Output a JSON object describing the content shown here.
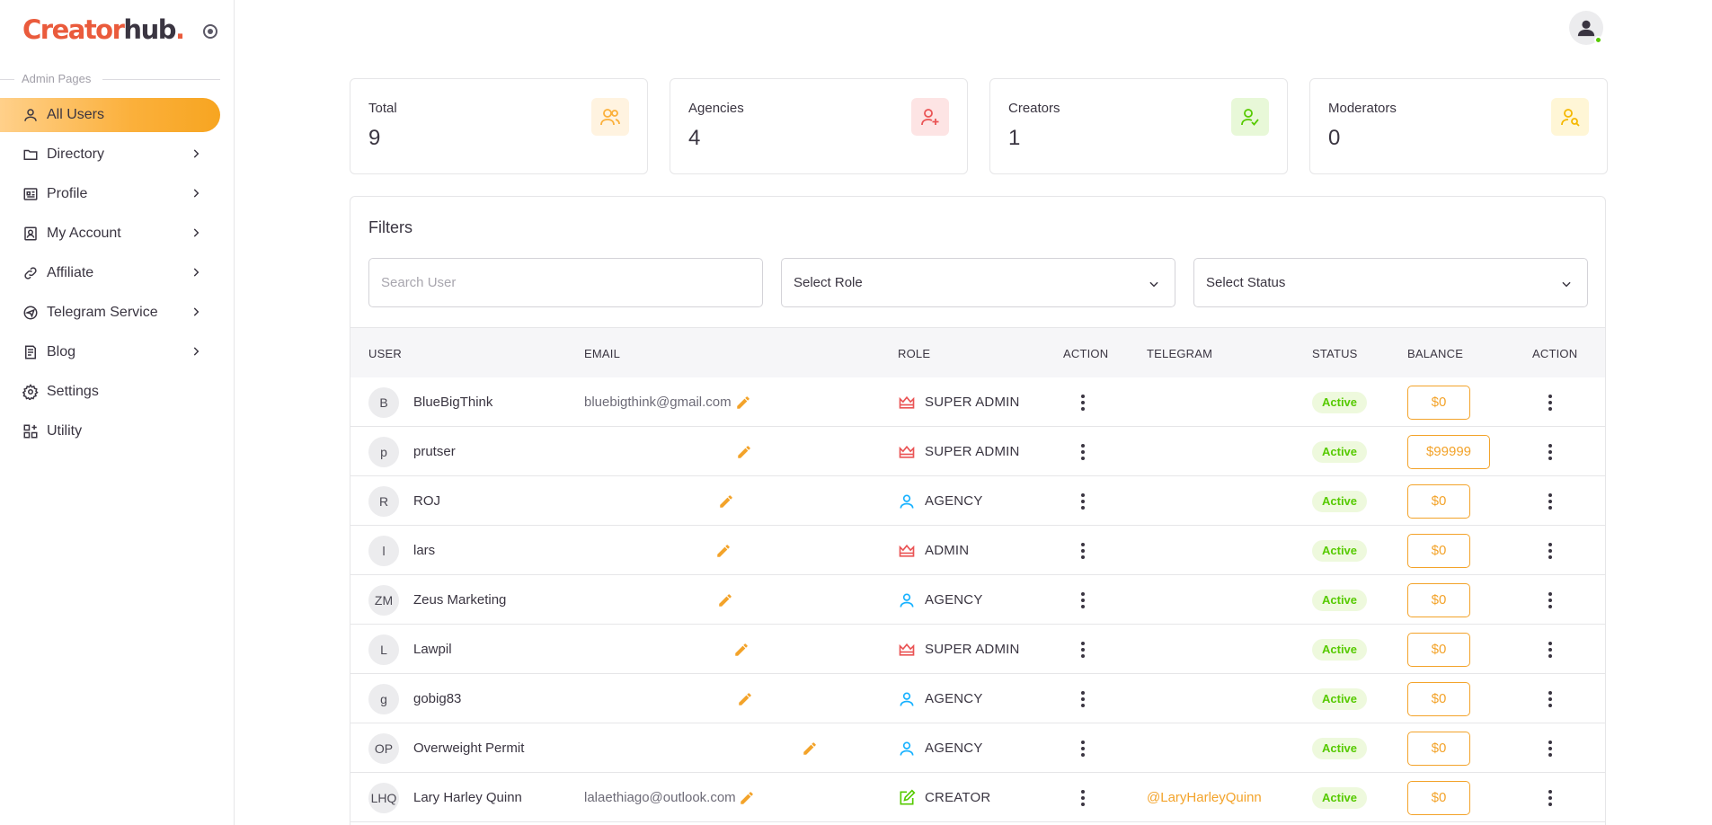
{
  "brand": {
    "part1": "Creator",
    "part2": "hub",
    "dot": "."
  },
  "sidebar": {
    "section_label": "Admin Pages",
    "items": [
      {
        "label": "All Users",
        "icon": "user-icon"
      },
      {
        "label": "Directory",
        "icon": "folder-icon"
      },
      {
        "label": "Profile",
        "icon": "profile-card-icon"
      },
      {
        "label": "My Account",
        "icon": "account-icon"
      },
      {
        "label": "Affiliate",
        "icon": "link-icon"
      },
      {
        "label": "Telegram Service",
        "icon": "telegram-icon"
      },
      {
        "label": "Blog",
        "icon": "blog-icon"
      },
      {
        "label": "Settings",
        "icon": "gear-icon"
      },
      {
        "label": "Utility",
        "icon": "grid-icon"
      }
    ]
  },
  "stats": [
    {
      "label": "Total",
      "value": "9",
      "icon": "users-icon",
      "color": "#fbb03b",
      "bg": "#fff3e0"
    },
    {
      "label": "Agencies",
      "value": "4",
      "icon": "user-plus-icon",
      "color": "#ea5455",
      "bg": "#fde4e4"
    },
    {
      "label": "Creators",
      "value": "1",
      "icon": "user-check-icon",
      "color": "#56ca00",
      "bg": "#e8f8d8"
    },
    {
      "label": "Moderators",
      "value": "0",
      "icon": "user-search-icon",
      "color": "#f5b800",
      "bg": "#fff6d6"
    }
  ],
  "filters": {
    "title": "Filters",
    "search_placeholder": "Search User",
    "role_placeholder": "Select Role",
    "status_placeholder": "Select Status"
  },
  "table": {
    "headers": [
      "USER",
      "EMAIL",
      "ROLE",
      "ACTION",
      "TELEGRAM",
      "STATUS",
      "BALANCE",
      "ACTION"
    ],
    "rows": [
      {
        "initials": "B",
        "name": "BlueBigThink",
        "email": "bluebigthink@gmail.com",
        "role": "SUPER ADMIN",
        "role_icon": "crown-icon",
        "telegram": "",
        "status": "Active",
        "balance": "$0"
      },
      {
        "initials": "p",
        "name": "prutser",
        "email": "",
        "role": "SUPER ADMIN",
        "role_icon": "crown-icon",
        "telegram": "",
        "status": "Active",
        "balance": "$99999"
      },
      {
        "initials": "R",
        "name": "ROJ",
        "email": "",
        "role": "AGENCY",
        "role_icon": "user-outline-icon",
        "telegram": "",
        "status": "Active",
        "balance": "$0"
      },
      {
        "initials": "l",
        "name": "lars",
        "email": "",
        "role": "ADMIN",
        "role_icon": "crown-icon",
        "telegram": "",
        "status": "Active",
        "balance": "$0"
      },
      {
        "initials": "ZM",
        "name": "Zeus Marketing",
        "email": "",
        "role": "AGENCY",
        "role_icon": "user-outline-icon",
        "telegram": "",
        "status": "Active",
        "balance": "$0"
      },
      {
        "initials": "L",
        "name": "Lawpil",
        "email": "",
        "role": "SUPER ADMIN",
        "role_icon": "crown-icon",
        "telegram": "",
        "status": "Active",
        "balance": "$0"
      },
      {
        "initials": "g",
        "name": "gobig83",
        "email": "",
        "role": "AGENCY",
        "role_icon": "user-outline-icon",
        "telegram": "",
        "status": "Active",
        "balance": "$0"
      },
      {
        "initials": "OP",
        "name": "Overweight Permit",
        "email": "",
        "role": "AGENCY",
        "role_icon": "user-outline-icon",
        "telegram": "",
        "status": "Active",
        "balance": "$0"
      },
      {
        "initials": "LHQ",
        "name": "Lary Harley Quinn",
        "email": "lalaethiago@outlook.com",
        "role": "CREATOR",
        "role_icon": "edit-square-icon",
        "telegram": "@LaryHarleyQuinn",
        "status": "Active",
        "balance": "$0"
      }
    ]
  }
}
